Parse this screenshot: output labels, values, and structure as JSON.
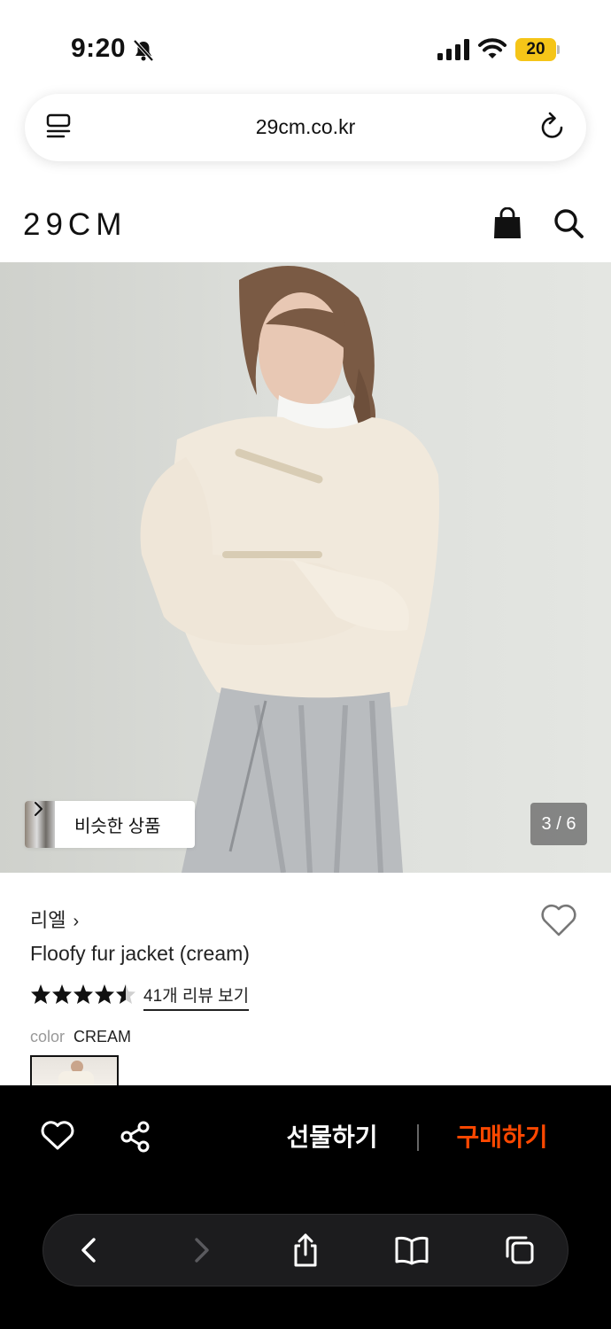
{
  "status_bar": {
    "time": "9:20",
    "battery": "20"
  },
  "browser": {
    "url": "29cm.co.kr"
  },
  "site": {
    "logo": "29CM"
  },
  "gallery": {
    "similar_label": "비슷한 상품",
    "pager": "3 / 6"
  },
  "product": {
    "brand": "리엘",
    "brand_chevron": "›",
    "name": "Floofy fur jacket (cream)",
    "rating": 4.5,
    "reviews_link": "41개 리뷰 보기",
    "color_label": "color",
    "color_value": "CREAM"
  },
  "purchase_bar": {
    "gift_label": "선물하기",
    "buy_label": "구매하기",
    "buy_color": "#ff4800"
  },
  "icons": [
    "bell-slash-icon",
    "signal-icon",
    "wifi-icon",
    "tabs-icon",
    "reload-icon",
    "bag-icon",
    "search-icon",
    "heart-icon",
    "share-icon",
    "back-icon",
    "forward-icon",
    "share-up-icon",
    "bookmarks-icon",
    "tabs-overview-icon"
  ]
}
